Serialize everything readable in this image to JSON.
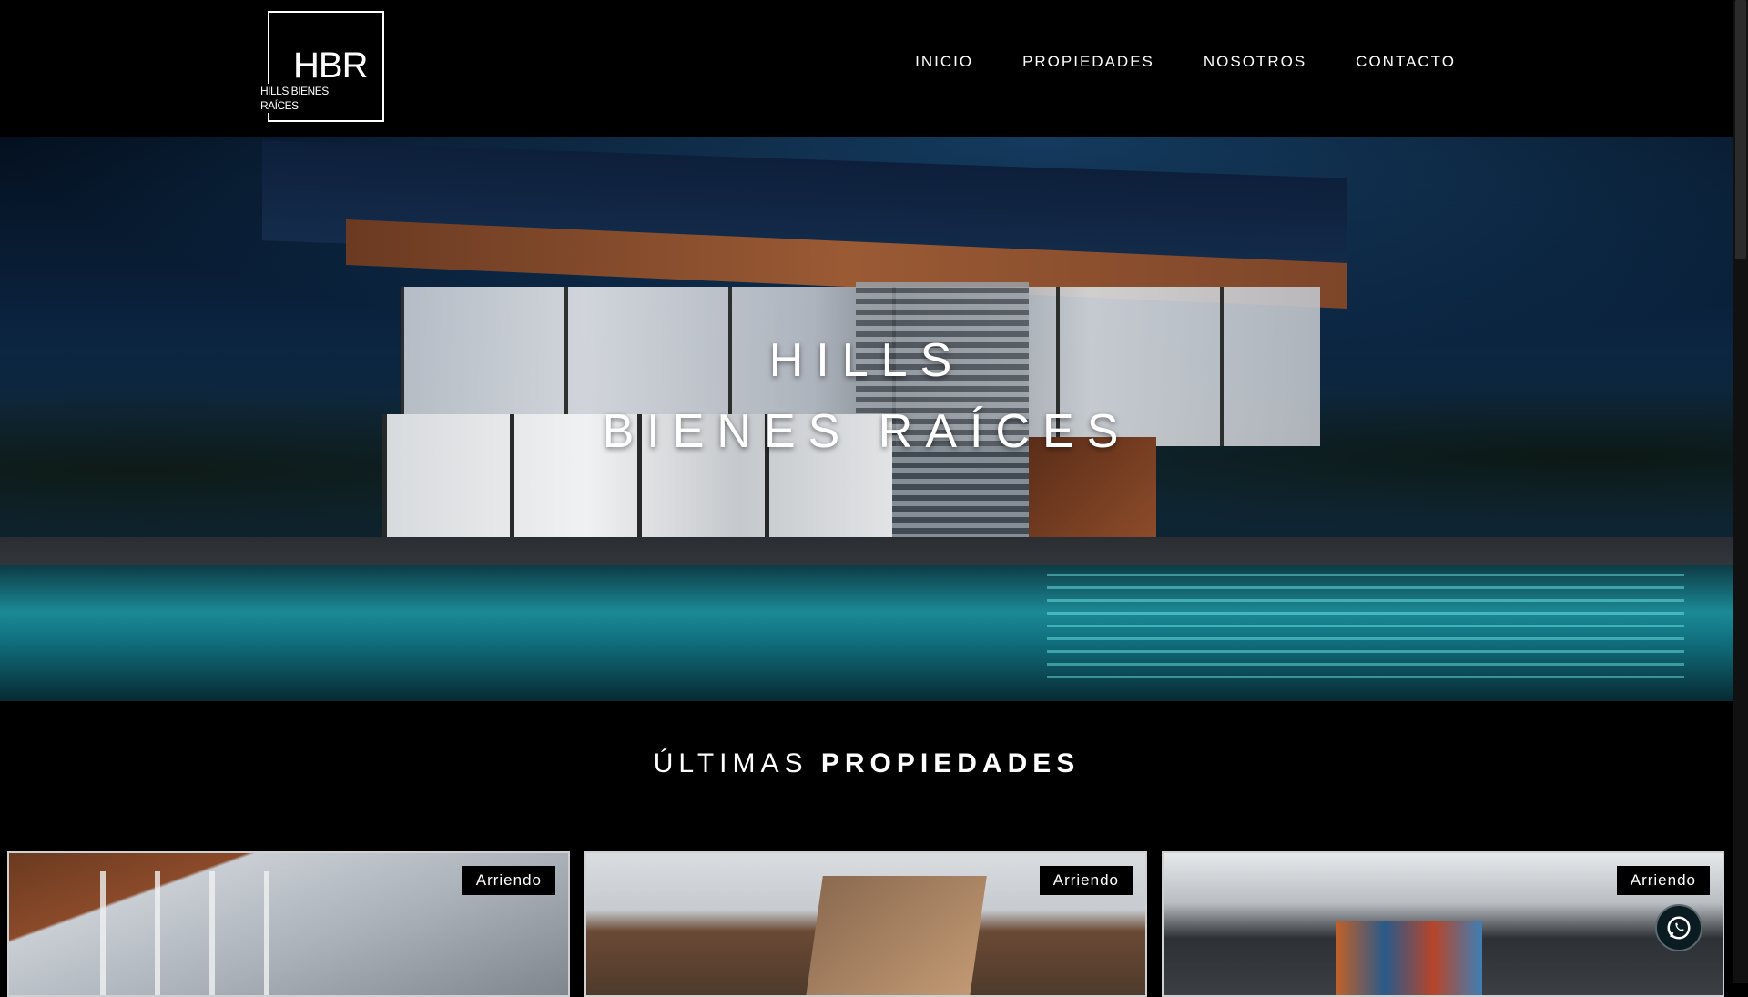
{
  "logo": {
    "mark": "HBR",
    "subtitle": "HILLS BIENES RAÍCES"
  },
  "nav": {
    "items": [
      {
        "label": "INICIO"
      },
      {
        "label": "PROPIEDADES"
      },
      {
        "label": "NOSOTROS"
      },
      {
        "label": "CONTACTO"
      }
    ]
  },
  "hero": {
    "title_line1": "HILLS",
    "title_line2": "BIENES RAÍCES"
  },
  "section": {
    "title_light": "ÚLTIMAS",
    "title_bold": "PROPIEDADES"
  },
  "cards": [
    {
      "badge": "Arriendo"
    },
    {
      "badge": "Arriendo"
    },
    {
      "badge": "Arriendo"
    }
  ],
  "floating": {
    "icon": "whatsapp-icon"
  },
  "colors": {
    "background": "#000000",
    "text": "#ffffff",
    "pool_accent": "#1b8a96"
  }
}
